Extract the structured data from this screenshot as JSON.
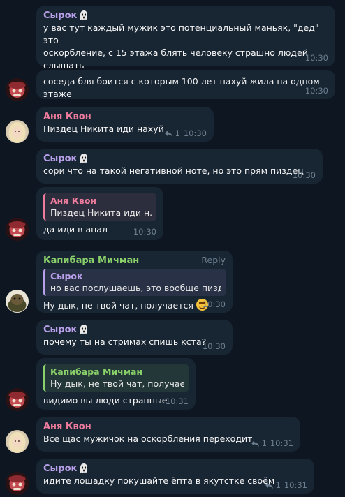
{
  "colors": {
    "bg": "#0e1621",
    "bubble": "#182533",
    "syrok": "#b9a0ea",
    "anya": "#ee7b9c",
    "kapibara": "#8ad16a",
    "meta": "#6d7f8f"
  },
  "messages": [
    {
      "author": "Сырок",
      "lines": [
        "у вас тут каждый мужик это потенциальный маньяк, \"дед\" это",
        "оскорбление, с 15 этажа блять человеку страшно людей",
        "слышать"
      ],
      "time": "10:30"
    },
    {
      "lines": [
        "соседа бля боится с которым 100 лет нахуй жила на одном этаже"
      ],
      "time": "10:30"
    },
    {
      "author": "Аня Квон",
      "lines": [
        "Пиздец Никита иди нахуй"
      ],
      "replies": "1",
      "time": "10:30"
    },
    {
      "author": "Сырок",
      "lines": [
        "сори что на такой негативной ноте, но это прям пиздец"
      ],
      "time": "10:30"
    },
    {
      "quote_author": "Аня Квон",
      "quote_text": "Пиздец Никита иди н...",
      "lines": [
        "да иди в анал"
      ],
      "time": "10:30"
    },
    {
      "author": "Капибара Мичман",
      "reply_label": "Reply",
      "quote_author": "Сырок",
      "quote_text": "но вас послушаешь, это вообще пизд...",
      "lines": [
        "Ну дык, не твой чат, получается"
      ],
      "time": "10:30"
    },
    {
      "author": "Сырок",
      "lines": [
        "почему ты на стримах спишь кста?"
      ],
      "time": "10:30"
    },
    {
      "quote_author": "Капибара Мичман",
      "quote_text": "Ну дык, не твой чат, получае...",
      "lines": [
        "видимо вы люди странные"
      ],
      "time": "10:31"
    },
    {
      "author": "Аня Квон",
      "lines": [
        "Все щас мужичок на оскорбления переходит"
      ],
      "replies": "1",
      "time": "10:31"
    },
    {
      "author": "Сырок",
      "lines": [
        "идите лошадку покушайте ёпта в якутстке своём"
      ],
      "replies": "1",
      "time": "10:31"
    }
  ]
}
